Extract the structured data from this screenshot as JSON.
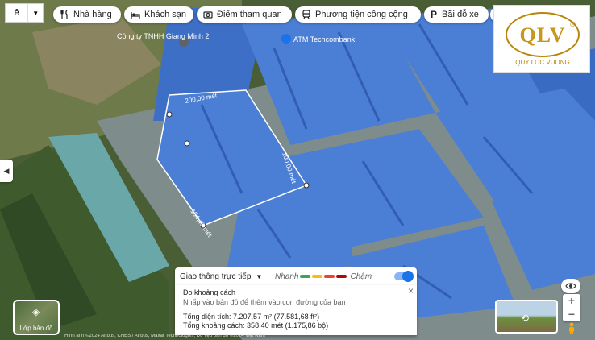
{
  "language": {
    "value": "ê",
    "icon": "chevron-down-icon"
  },
  "categories": [
    {
      "label": "Nhà hàng",
      "icon": "restaurant-icon"
    },
    {
      "label": "Khách sạn",
      "icon": "hotel-icon"
    },
    {
      "label": "Điểm tham quan",
      "icon": "camera-icon"
    },
    {
      "label": "Phương tiện công cộng",
      "icon": "transit-icon"
    },
    {
      "label": "Bãi đỗ xe",
      "icon": "parking-icon",
      "prefix": "P"
    }
  ],
  "more_chevron": "›",
  "map_labels": {
    "company": "Công ty TNHH Giang Minh 2",
    "atm": "ATM Techcombank",
    "dist_top": "200,00 mét",
    "dist_right": "100,00 mét",
    "dist_bottom": "154,40 mét"
  },
  "logo": {
    "text": "QLV",
    "tagline": "QUY LOC VUONG",
    "reg": "®",
    "accent": "#b8860b"
  },
  "layers": {
    "label": "Lớp bản đồ"
  },
  "traffic": {
    "mode": "Giao thông trực tiếp",
    "fast": "Nhanh",
    "slow": "Chậm",
    "colors": [
      "#34a853",
      "#fbbc04",
      "#ea4335",
      "#a50e0e"
    ]
  },
  "measure": {
    "title": "Đo khoảng cách",
    "hint": "Nhấp vào bản đồ để thêm vào con đường của bạn",
    "area": "Tổng diện tích: 7.207,57 m² (77.581,68 ft²)",
    "distance": "Tổng khoảng cách: 358,40 mét (1.175,86 bộ)",
    "close": "×"
  },
  "controls": {
    "zoom_in": "+",
    "zoom_out": "−"
  },
  "footer": "Hình ảnh ©2024 Airbus, CNES / Airbus, Maxar Technologies, Dữ liệu bản đồ ©2024   Việt Nam"
}
